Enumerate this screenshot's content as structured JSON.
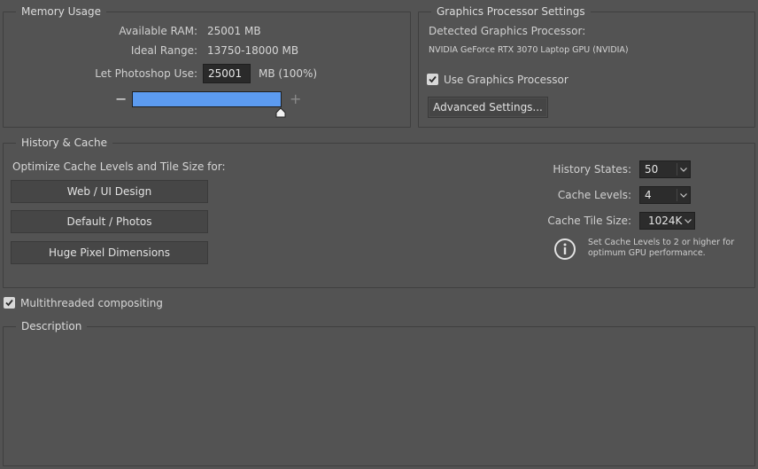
{
  "memory": {
    "title": "Memory Usage",
    "available_label": "Available RAM:",
    "available_value": "25001 MB",
    "ideal_label": "Ideal Range:",
    "ideal_value": "13750-18000 MB",
    "let_label": "Let Photoshop Use:",
    "let_value": "25001",
    "let_suffix": "MB (100%)",
    "slider_fraction": 1.0,
    "minus": "−",
    "plus": "+"
  },
  "gpu": {
    "title": "Graphics Processor Settings",
    "detected_label": "Detected Graphics Processor:",
    "detected_value": "NVIDIA GeForce RTX 3070 Laptop GPU (NVIDIA)",
    "use_label": "Use Graphics Processor",
    "use_checked": true,
    "advanced_button": "Advanced Settings..."
  },
  "history": {
    "title": "History & Cache",
    "optimize_label": "Optimize Cache Levels and Tile Size for:",
    "buttons": [
      "Web / UI Design",
      "Default / Photos",
      "Huge Pixel Dimensions"
    ],
    "states_label": "History States:",
    "states_value": "50",
    "levels_label": "Cache Levels:",
    "levels_value": "4",
    "tile_label": "Cache Tile Size:",
    "tile_value": "1024K",
    "note_line1": "Set Cache Levels to 2 or higher for",
    "note_line2": "optimum GPU performance."
  },
  "multithreaded": {
    "label": "Multithreaded compositing",
    "checked": true
  },
  "description": {
    "title": "Description"
  },
  "colors": {
    "background": "#535353",
    "slider": "#5c9bf0",
    "field": "#2a2a2a"
  }
}
